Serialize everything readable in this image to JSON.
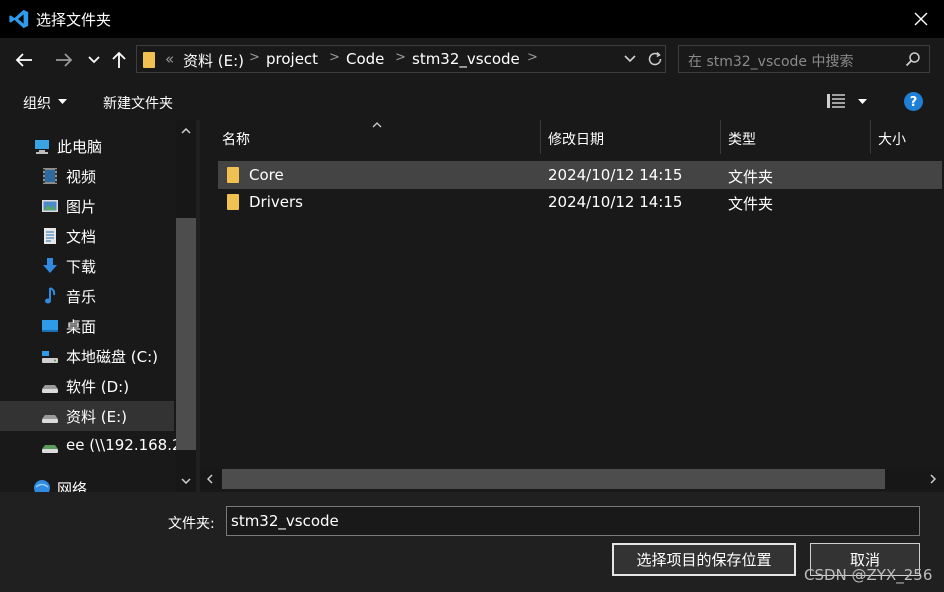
{
  "window": {
    "title": "选择文件夹",
    "close_icon": "close-icon"
  },
  "address": {
    "overflow": "«",
    "crumbs": [
      "资料 (E:)",
      "project",
      "Code",
      "stm32_vscode"
    ],
    "search_placeholder": "在 stm32_vscode 中搜索"
  },
  "toolbar": {
    "organize": "组织",
    "new_folder": "新建文件夹"
  },
  "nav": {
    "items": [
      {
        "label": "此电脑",
        "icon": "pc-icon"
      },
      {
        "label": "视频",
        "icon": "video-icon"
      },
      {
        "label": "图片",
        "icon": "picture-icon"
      },
      {
        "label": "文档",
        "icon": "document-icon"
      },
      {
        "label": "下载",
        "icon": "download-icon"
      },
      {
        "label": "音乐",
        "icon": "music-icon"
      },
      {
        "label": "桌面",
        "icon": "desktop-icon"
      },
      {
        "label": "本地磁盘 (C:)",
        "icon": "drive-icon"
      },
      {
        "label": "软件 (D:)",
        "icon": "drive-icon"
      },
      {
        "label": "资料 (E:)",
        "icon": "drive-icon"
      },
      {
        "label": "ee (\\\\192.168.2",
        "icon": "network-drive-icon"
      },
      {
        "label": "网络",
        "icon": "network-icon"
      }
    ],
    "selected": "资料 (E:)"
  },
  "columns": {
    "name": "名称",
    "modified": "修改日期",
    "type": "类型",
    "size": "大小"
  },
  "files": [
    {
      "name": "Core",
      "modified": "2024/10/12 14:15",
      "type": "文件夹"
    },
    {
      "name": "Drivers",
      "modified": "2024/10/12 14:15",
      "type": "文件夹"
    }
  ],
  "footer": {
    "folder_label": "文件夹:",
    "folder_value": "stm32_vscode",
    "save_button": "选择项目的保存位置",
    "cancel_button": "取消",
    "watermark": "CSDN @ZYX_256"
  },
  "colors": {
    "accent": "#0078d4",
    "folder": "#f0c050",
    "help": "#1e7fd6"
  }
}
